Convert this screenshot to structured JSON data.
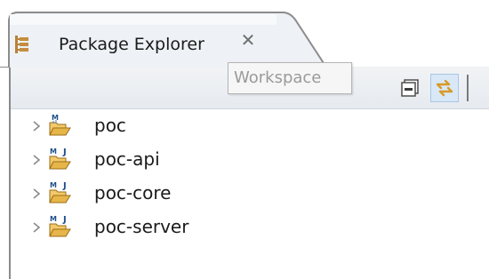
{
  "view": {
    "title": "Package Explorer",
    "icon": "package-explorer-icon",
    "close_glyph": "✕"
  },
  "toolbar": {
    "tooltip": "Workspace",
    "buttons": [
      {
        "name": "collapse-all",
        "icon": "collapse-all-icon"
      },
      {
        "name": "link-with-editor",
        "icon": "link-with-editor-icon",
        "pressed": true
      }
    ]
  },
  "tree": {
    "items": [
      {
        "label": "poc",
        "icon": "maven-project-icon",
        "expanded": false
      },
      {
        "label": "poc-api",
        "icon": "maven-java-project-icon",
        "expanded": false
      },
      {
        "label": "poc-core",
        "icon": "maven-java-project-icon",
        "expanded": false
      },
      {
        "label": "poc-server",
        "icon": "maven-java-project-icon",
        "expanded": false
      }
    ]
  },
  "colors": {
    "tab_border": "#8c8c8c",
    "toolbar_bg": "#e9edf1",
    "folder": "#e7b64a"
  }
}
